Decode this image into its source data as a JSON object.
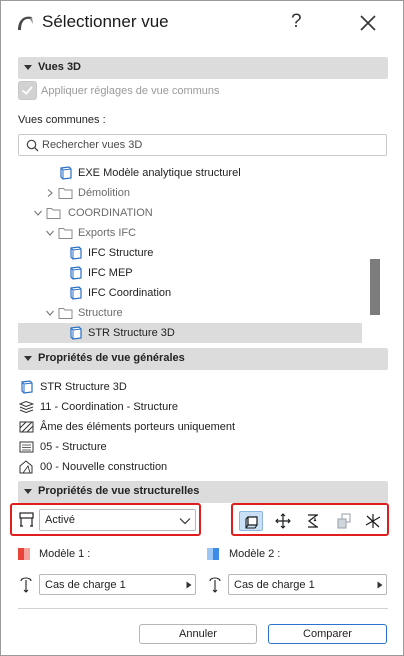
{
  "window": {
    "title": "Sélectionner vue",
    "help_label": "?"
  },
  "section_3d": {
    "label": "Vues 3D"
  },
  "apply_common": {
    "label": "Appliquer réglages de vue communs",
    "checked": true,
    "disabled": true
  },
  "common_views_label": "Vues communes :",
  "search": {
    "placeholder": "Rechercher vues 3D"
  },
  "tree": [
    {
      "label": "EXE Modèle analytique structurel",
      "kind": "view"
    },
    {
      "label": "Démolition",
      "kind": "folder",
      "state": "collapsed"
    },
    {
      "label": "COORDINATION",
      "kind": "folder",
      "state": "expanded"
    },
    {
      "label": "Exports IFC",
      "kind": "folder",
      "state": "expanded"
    },
    {
      "label": "IFC Structure",
      "kind": "view"
    },
    {
      "label": "IFC MEP",
      "kind": "view"
    },
    {
      "label": "IFC Coordination",
      "kind": "view"
    },
    {
      "label": "Structure",
      "kind": "folder",
      "state": "expanded"
    },
    {
      "label": "STR Structure 3D",
      "kind": "view",
      "selected": true
    }
  ],
  "general_props": {
    "label": "Propriétés de vue générales",
    "items": [
      {
        "icon": "view-cube-icon",
        "label": "STR Structure 3D"
      },
      {
        "icon": "layers-icon",
        "label": "11 - Coordination - Structure"
      },
      {
        "icon": "hatch-icon",
        "label": "Âme des éléments porteurs uniquement"
      },
      {
        "icon": "pen-set-icon",
        "label": "05 - Structure"
      },
      {
        "icon": "renovation-icon",
        "label": "00 - Nouvelle construction"
      }
    ]
  },
  "structural_props": {
    "label": "Propriétés de vue structurelles",
    "mode_value": "Activé",
    "tools": [
      "display-3d-icon",
      "supports-icon",
      "loads-icon",
      "analytical-model-icon",
      "axes-icon"
    ],
    "model1": {
      "label": "Modèle 1 :",
      "color": "#e8443a",
      "value": "Cas de charge 1"
    },
    "model2": {
      "label": "Modèle 2 :",
      "color": "#3d8be8",
      "value": "Cas de charge 1"
    }
  },
  "buttons": {
    "cancel": "Annuler",
    "compare": "Comparer"
  }
}
